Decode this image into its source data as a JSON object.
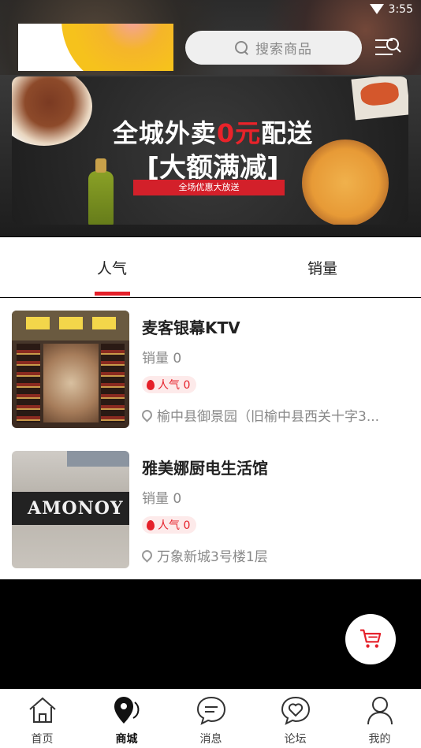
{
  "status": {
    "time": "3:55"
  },
  "search": {
    "placeholder": "搜索商品"
  },
  "banner": {
    "line1_a": "全城外卖",
    "line1_red": "0元",
    "line1_b": "配送",
    "line2": "[大额满减]",
    "ribbon": "全场优惠大放送"
  },
  "tabs": [
    {
      "label": "人气",
      "active": true
    },
    {
      "label": "销量",
      "active": false
    }
  ],
  "items": [
    {
      "title": "麦客银幕KTV",
      "sales": "销量 0",
      "popularity": "人气 0",
      "address": "榆中县御景园（旧榆中县西关十字3..."
    },
    {
      "title": "雅美娜厨电生活馆",
      "sales": "销量 0",
      "popularity": "人气 0",
      "address": "万象新城3号楼1层",
      "thumb_sign": "AMONOY"
    }
  ],
  "nav": [
    {
      "label": "首页",
      "icon": "home-icon"
    },
    {
      "label": "商城",
      "icon": "map-pin-icon",
      "active": true
    },
    {
      "label": "消息",
      "icon": "chat-icon"
    },
    {
      "label": "论坛",
      "icon": "heart-chat-icon"
    },
    {
      "label": "我的",
      "icon": "user-icon"
    }
  ],
  "colors": {
    "accent": "#e5202a",
    "text": "#222222",
    "muted": "#888888"
  }
}
